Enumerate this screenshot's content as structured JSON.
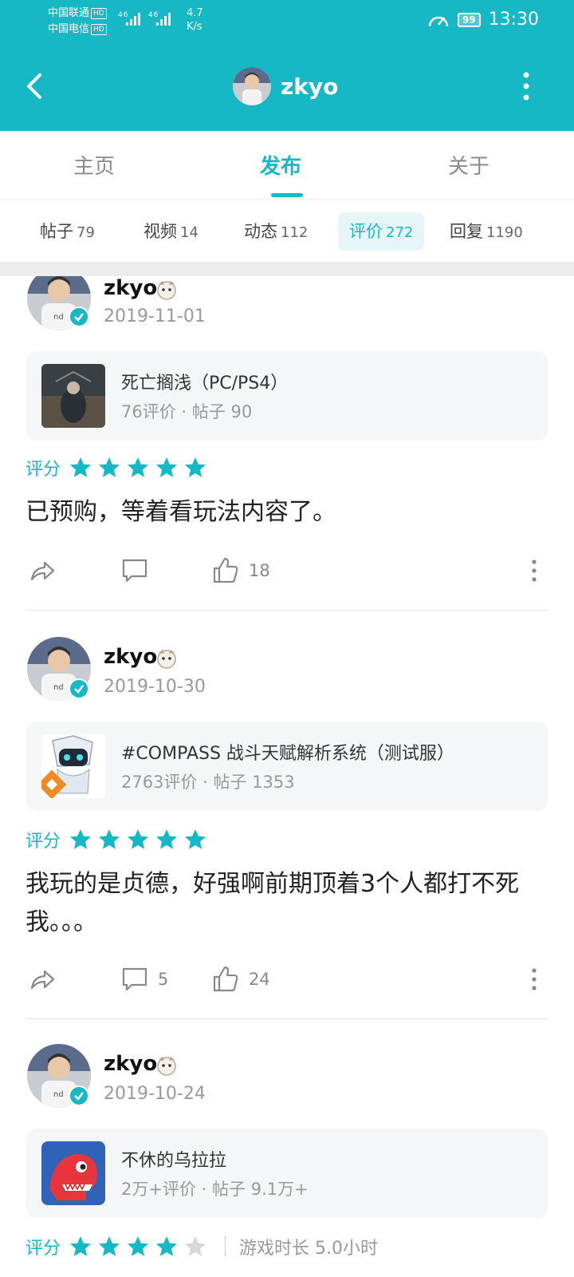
{
  "status_bar": {
    "carrier1": "中国联通",
    "carrier2": "中国电信",
    "hd": "HD",
    "signal": "46",
    "speed_value": "4.7",
    "speed_unit": "K/s",
    "battery": "99",
    "time": "13:30"
  },
  "header": {
    "title": "zkyo"
  },
  "tabs": [
    {
      "label": "主页"
    },
    {
      "label": "发布"
    },
    {
      "label": "关于"
    }
  ],
  "subtabs": [
    {
      "label": "帖子",
      "count": "79"
    },
    {
      "label": "视频",
      "count": "14"
    },
    {
      "label": "动态",
      "count": "112"
    },
    {
      "label": "评价",
      "count": "272"
    },
    {
      "label": "回复",
      "count": "1190"
    }
  ],
  "rating_label": "评分",
  "posts": [
    {
      "user": "zkyo",
      "date": "2019-11-01",
      "game_title": "死亡搁浅（PC/PS4）",
      "game_reviews": "76评价",
      "game_posts": "帖子 90",
      "stars": 5,
      "review": "已预购，等着看玩法内容了。",
      "comments": "",
      "likes": "18"
    },
    {
      "user": "zkyo",
      "date": "2019-10-30",
      "game_title": "#COMPASS 战斗天赋解析系统（测试服）",
      "game_reviews": "2763评价",
      "game_posts": "帖子 1353",
      "stars": 5,
      "review": "我玩的是贞德，好强啊前期顶着3个人都打不死我。。。",
      "comments": "5",
      "likes": "24"
    },
    {
      "user": "zkyo",
      "date": "2019-10-24",
      "game_title": "不休的乌拉拉",
      "game_reviews": "2万+评价",
      "game_posts": "帖子 9.1万+",
      "stars": 4,
      "playtime": "游戏时长 5.0小时"
    }
  ],
  "meta_dot": "·",
  "colors": {
    "accent": "#16b8c6",
    "star_empty": "#d8d8d8"
  }
}
